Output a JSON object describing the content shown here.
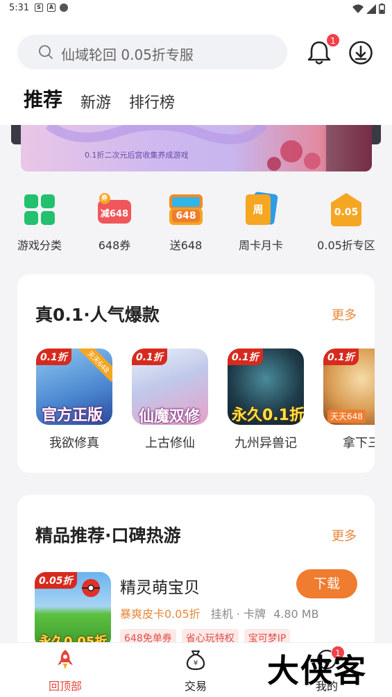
{
  "status_bar": {
    "time": "5:31",
    "icons": [
      "s-app-icon",
      "a-app-icon",
      "dot-icon",
      "wifi-icon",
      "signal-icon",
      "battery-icon"
    ]
  },
  "search": {
    "placeholder": "仙域轮回 0.05折专服"
  },
  "notifications": {
    "badge": "1"
  },
  "tabs": [
    {
      "label": "推荐",
      "active": true
    },
    {
      "label": "新游",
      "active": false
    },
    {
      "label": "排行榜",
      "active": false
    }
  ],
  "banner": {
    "subtitle": "0.1折二次元后宫收集养成游戏"
  },
  "quick_entries": [
    {
      "label": "游戏分类",
      "icon": "grid-icon"
    },
    {
      "label": "648券",
      "icon": "coupon-icon",
      "icon_text": "减648",
      "corner": "券"
    },
    {
      "label": "送648",
      "icon": "gift-648-icon",
      "icon_text": "648"
    },
    {
      "label": "周卡月卡",
      "icon": "week-card-icon",
      "icon_text": "周"
    },
    {
      "label": "0.05折专区",
      "icon": "discount-zone-icon",
      "icon_text": "0.05"
    }
  ],
  "hot_section": {
    "title": "真0.1·人气爆款",
    "more": "更多",
    "games": [
      {
        "name": "我欲修真",
        "tag": "0.1折",
        "corner": "天天648",
        "ribbon": "官方正版"
      },
      {
        "name": "上古修仙",
        "tag": "0.1折",
        "ribbon": "仙魔双修"
      },
      {
        "name": "九州异兽记",
        "tag": "0.1折",
        "ribbon": "永久0.1折"
      },
      {
        "name": "拿下三",
        "tag": "0.1折",
        "corner": "天天648"
      }
    ]
  },
  "recommend_section": {
    "title": "精品推荐·口碑热游",
    "more": "更多",
    "item": {
      "name": "精灵萌宝贝",
      "icon_tag": "0.05折",
      "icon_ribbon": "永久0.05折",
      "highlight": "暴爽皮卡0.05折",
      "meta": "挂机 · 卡牌",
      "size": "4.80 MB",
      "tags": [
        "648免单券",
        "省心玩特权",
        "宝可梦IP"
      ],
      "button": "下载"
    }
  },
  "bottom_nav": [
    {
      "label": "回顶部",
      "icon": "rocket-icon",
      "active": true
    },
    {
      "label": "交易",
      "icon": "money-bag-icon",
      "active": false
    },
    {
      "label": "我的",
      "icon": "profile-icon",
      "active": false,
      "badge": "1"
    }
  ],
  "watermark": "大侠客",
  "colors": {
    "accent": "#ef7c2f",
    "more": "#e8863a",
    "badge": "#f0404a",
    "active_nav": "#e4463c"
  }
}
